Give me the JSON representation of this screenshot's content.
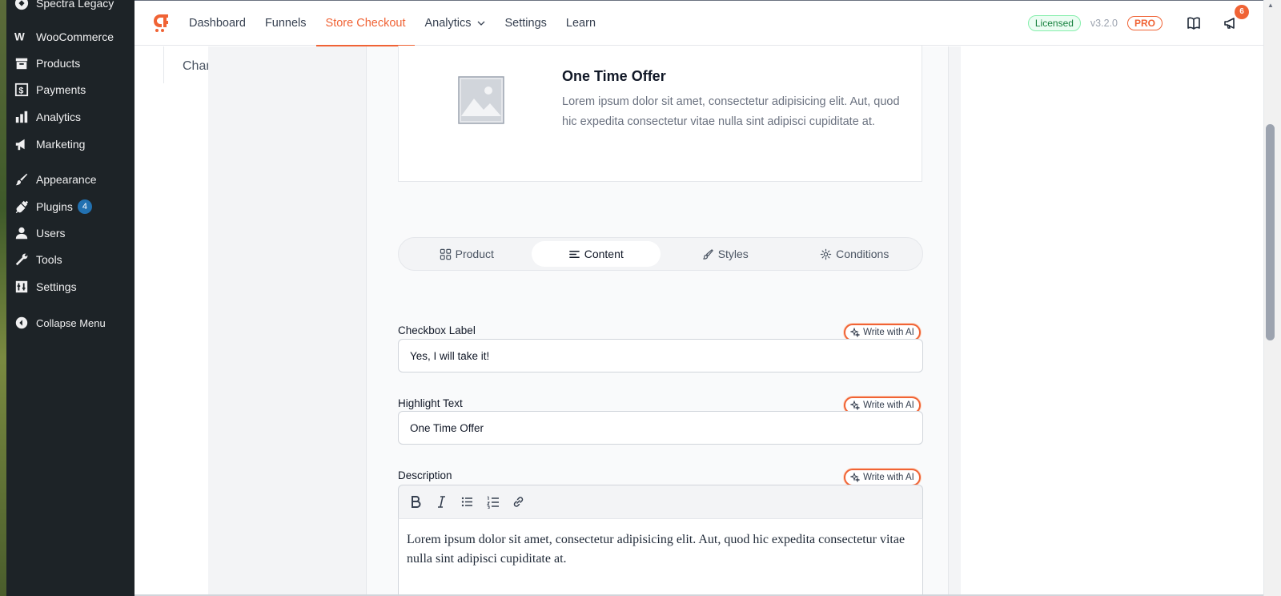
{
  "wp_menu": {
    "items": [
      {
        "label": "Spectra Legacy",
        "icon": "spectra-icon"
      },
      {
        "label": "WooCommerce",
        "icon": "woocommerce-icon"
      },
      {
        "label": "Products",
        "icon": "archive-icon"
      },
      {
        "label": "Payments",
        "icon": "payments-icon"
      },
      {
        "label": "Analytics",
        "icon": "bar-chart-icon"
      },
      {
        "label": "Marketing",
        "icon": "megaphone-icon"
      },
      {
        "label": "Appearance",
        "icon": "paintbrush-icon"
      },
      {
        "label": "Plugins",
        "icon": "plugin-icon",
        "badge": "4"
      },
      {
        "label": "Users",
        "icon": "user-icon"
      },
      {
        "label": "Tools",
        "icon": "wrench-icon"
      },
      {
        "label": "Settings",
        "icon": "settings-icon"
      },
      {
        "label": "Collapse Menu",
        "icon": "collapse-icon"
      }
    ]
  },
  "topbar": {
    "nav": [
      "Dashboard",
      "Funnels",
      "Store Checkout",
      "Analytics",
      "Settings",
      "Learn"
    ],
    "active": "Store Checkout",
    "licensed": "Licensed",
    "version": "v3.2.0",
    "pro": "PRO",
    "notifications": "6"
  },
  "side_panel": {
    "change_template": "Change Template"
  },
  "preview": {
    "title": "One Time Offer",
    "description": "Lorem ipsum dolor sit amet, consectetur adipisicing elit. Aut, quod hic expedita consectetur vitae nulla sint adipisci cupiditate at."
  },
  "tabs": [
    "Product",
    "Content",
    "Styles",
    "Conditions"
  ],
  "active_tab": "Content",
  "form": {
    "checkbox_label": {
      "label": "Checkbox Label",
      "value": "Yes, I will take it!"
    },
    "highlight_text": {
      "label": "Highlight Text",
      "value": "One Time Offer"
    },
    "description": {
      "label": "Description",
      "value": "Lorem ipsum dolor sit amet, consectetur adipisicing elit. Aut, quod hic expedita consectetur vitae nulla sint adipisci cupiditate at."
    },
    "ai_button": "Write with AI"
  },
  "colors": {
    "accent": "#f06335",
    "sidebar_bg": "#1d2327",
    "licensed_green": "#15803d"
  }
}
